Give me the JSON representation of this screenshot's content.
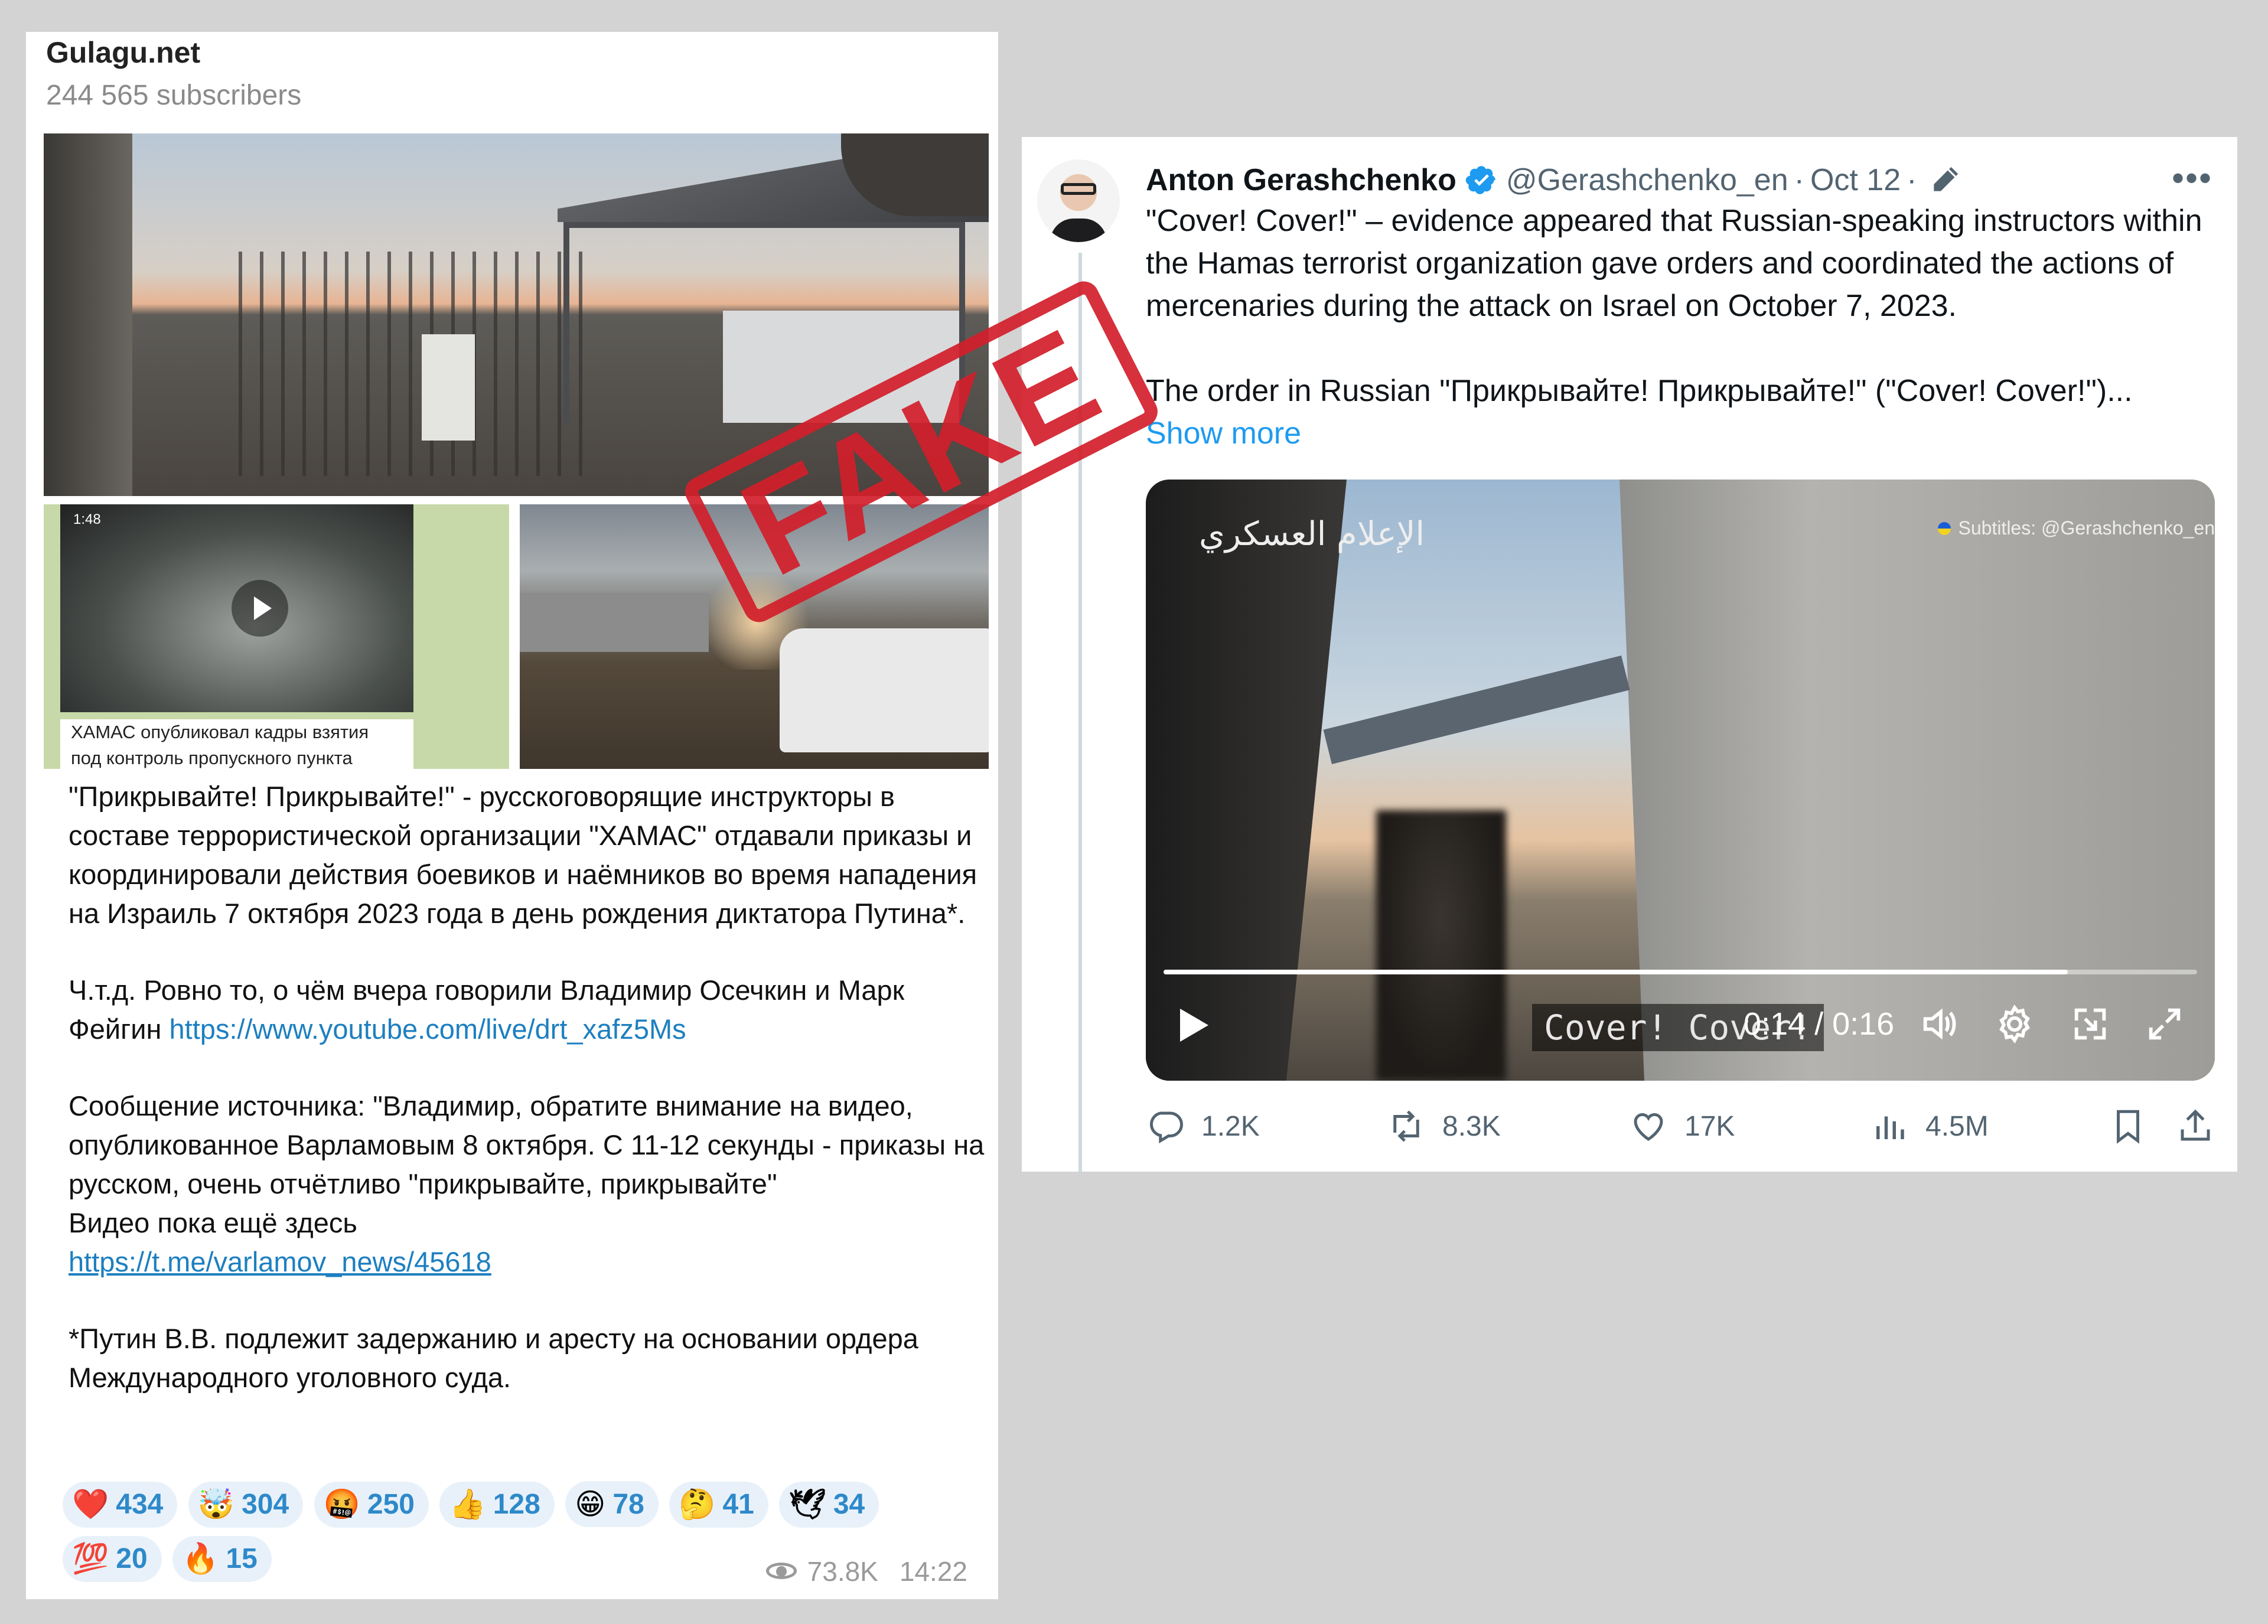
{
  "telegram": {
    "channel_name": "Gulagu.net",
    "subscribers": "244 565 subscribers",
    "thumb_duration": "1:48",
    "thumb_caption_line1": "ХАМАС опубликовал кадры взятия",
    "thumb_caption_line2": "под контроль пропускного пункта",
    "para1": "\"Прикрывайте! Прикрывайте!\" - русскоговорящие инструкторы в составе террористической организации \"ХАМАС\" отдавали приказы и координировали действия боевиков и наёмников во время нападения на Израиль 7 октября 2023 года в день рождения диктатора Путина*.",
    "para2_text": "Ч.т.д. Ровно то, о чём вчера говорили Владимир Осечкин и Марк Фейгин ",
    "para2_link": "https://www.youtube.com/live/drt_xafz5Ms",
    "para3_text": "Сообщение источника: \"Владимир, обратите внимание на видео, опубликованное Варламовым 8 октября. С 11-12 секунды - приказы на русском, очень отчётливо \"прикрывайте, прикрывайте\"\nВидео пока ещё здесь\n",
    "para3_link": "https://t.me/varlamov_news/45618",
    "para4": "*Путин В.В. подлежит задержанию и аресту на основании ордера Международного уголовного суда.",
    "reactions": [
      {
        "emoji": "❤️",
        "count": "434"
      },
      {
        "emoji": "🤯",
        "count": "304"
      },
      {
        "emoji": "🤬",
        "count": "250"
      },
      {
        "emoji": "👍",
        "count": "128"
      },
      {
        "emoji": "😁",
        "count": "78"
      },
      {
        "emoji": "🤔",
        "count": "41"
      },
      {
        "emoji": "🕊",
        "count": "34"
      },
      {
        "emoji": "💯",
        "count": "20"
      },
      {
        "emoji": "🔥",
        "count": "15"
      }
    ],
    "views": "73.8K",
    "time": "14:22"
  },
  "stamp": {
    "text": "FAKE",
    "color": "#d21f2b"
  },
  "twitter": {
    "name": "Anton Gerashchenko",
    "handle": "@Gerashchenko_en",
    "sep": "·",
    "date": "Oct 12",
    "text1": "\"Cover! Cover!\" – evidence appeared that Russian-speaking instructors within the Hamas terrorist organization gave orders and coordinated the actions of mercenaries during the attack on Israel on October 7, 2023.",
    "text2": "The order in Russian \"Прикрывайте! Прикрывайте!\" (\"Cover! Cover!\")...",
    "show_more": "Show more",
    "video": {
      "logo_text": "الإعلام العسكري",
      "subtitle_credit": "Subtitles: @Gerashchenko_en",
      "subtitle": "Cover! Cover!",
      "time": "0:14 / 0:16",
      "progress": 0.875
    },
    "actions": {
      "replies": "1.2K",
      "reposts": "8.3K",
      "likes": "17K",
      "views": "4.5M"
    },
    "accent_color": "#1d9bf0"
  }
}
